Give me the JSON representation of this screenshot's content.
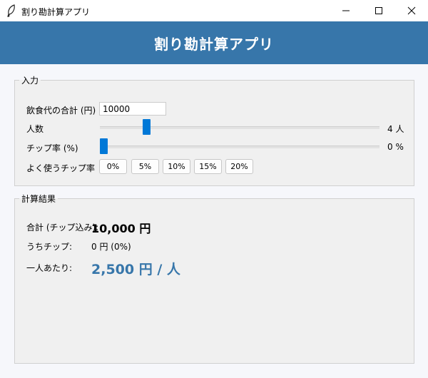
{
  "window": {
    "title": "割り勘計算アプリ",
    "icon": "feather-icon",
    "controls": [
      "minimize-icon",
      "maximize-icon",
      "close-icon"
    ]
  },
  "header": {
    "title": "割り勘計算アプリ",
    "color": "#3776aa"
  },
  "input_section": {
    "legend": "入力",
    "total_label": "飲食代の合計 (円)",
    "total_value": "10000",
    "people_label": "人数",
    "people_value": 4,
    "people_display": "4 人",
    "people_range": [
      1,
      20
    ],
    "tip_label": "チップ率 (%)",
    "tip_value": 0,
    "tip_display": "0 %",
    "tip_range": [
      0,
      30
    ],
    "presets_label": "よく使うチップ率",
    "presets": [
      "0%",
      "5%",
      "10%",
      "15%",
      "20%"
    ]
  },
  "result_section": {
    "legend": "計算結果",
    "total_label": "合計 (チップ込み):",
    "total_value": "10,000 円",
    "tip_label": "うちチップ:",
    "tip_value": "0 円 (0%)",
    "per_person_label": "一人あたり:",
    "per_person_value": "2,500 円 / 人",
    "accent_color": "#3776aa"
  },
  "slider_color": "#0078d7"
}
